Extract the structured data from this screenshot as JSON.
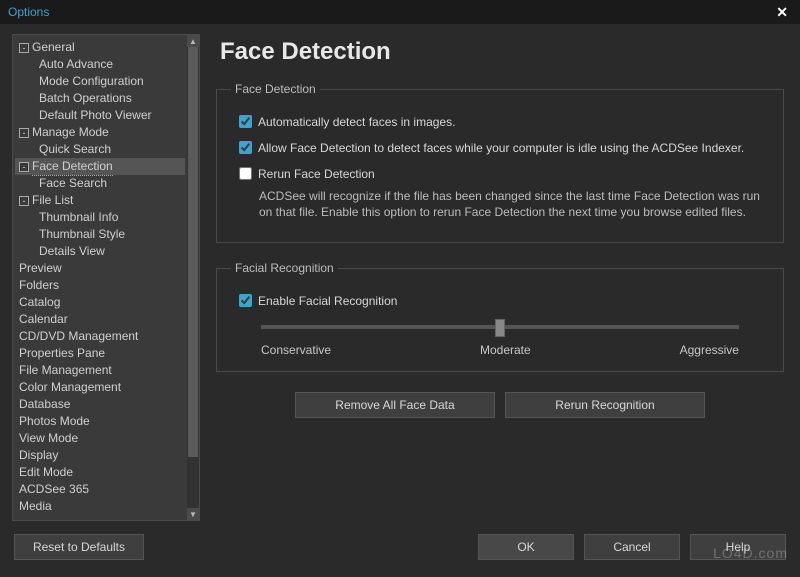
{
  "window": {
    "title": "Options"
  },
  "sidebar": {
    "reset_label": "Reset to Defaults",
    "items": [
      {
        "label": "General",
        "depth": 0,
        "toggle": "-"
      },
      {
        "label": "Auto Advance",
        "depth": 1
      },
      {
        "label": "Mode Configuration",
        "depth": 1
      },
      {
        "label": "Batch Operations",
        "depth": 1
      },
      {
        "label": "Default Photo Viewer",
        "depth": 1
      },
      {
        "label": "Manage Mode",
        "depth": 0,
        "toggle": "-"
      },
      {
        "label": "Quick Search",
        "depth": 1
      },
      {
        "label": "Face Detection",
        "depth": 0,
        "toggle": "-",
        "selected": true
      },
      {
        "label": "Face Search",
        "depth": 1
      },
      {
        "label": "File List",
        "depth": 0,
        "toggle": "-"
      },
      {
        "label": "Thumbnail Info",
        "depth": 1
      },
      {
        "label": "Thumbnail Style",
        "depth": 1
      },
      {
        "label": "Details View",
        "depth": 1
      },
      {
        "label": "Preview",
        "depth": 0
      },
      {
        "label": "Folders",
        "depth": 0
      },
      {
        "label": "Catalog",
        "depth": 0
      },
      {
        "label": "Calendar",
        "depth": 0
      },
      {
        "label": "CD/DVD Management",
        "depth": 0
      },
      {
        "label": "Properties Pane",
        "depth": 0
      },
      {
        "label": "File Management",
        "depth": 0
      },
      {
        "label": "Color Management",
        "depth": 0
      },
      {
        "label": "Database",
        "depth": 0
      },
      {
        "label": "Photos Mode",
        "depth": 0
      },
      {
        "label": "View Mode",
        "depth": 0
      },
      {
        "label": "Display",
        "depth": 0
      },
      {
        "label": "Edit Mode",
        "depth": 0
      },
      {
        "label": "ACDSee 365",
        "depth": 0
      },
      {
        "label": "Media",
        "depth": 0
      }
    ]
  },
  "page": {
    "title": "Face Detection",
    "face_detection": {
      "legend": "Face Detection",
      "auto_detect": {
        "checked": true,
        "label": "Automatically detect faces in images."
      },
      "idle_detect": {
        "checked": true,
        "label": "Allow Face Detection to detect faces while your computer is idle using the ACDSee Indexer."
      },
      "rerun": {
        "checked": false,
        "label": "Rerun Face Detection",
        "description": "ACDSee will recognize if the file has been changed since the last time Face Detection was run on that file. Enable this option to rerun Face Detection the next time you browse edited files."
      }
    },
    "facial_recognition": {
      "legend": "Facial Recognition",
      "enable": {
        "checked": true,
        "label": "Enable Facial Recognition"
      },
      "slider": {
        "value": 50,
        "left": "Conservative",
        "mid": "Moderate",
        "right": "Aggressive"
      }
    },
    "actions": {
      "remove_all": "Remove All Face Data",
      "rerun_recognition": "Rerun Recognition"
    }
  },
  "footer": {
    "ok": "OK",
    "cancel": "Cancel",
    "help": "Help"
  },
  "watermark": "LO4D.com"
}
